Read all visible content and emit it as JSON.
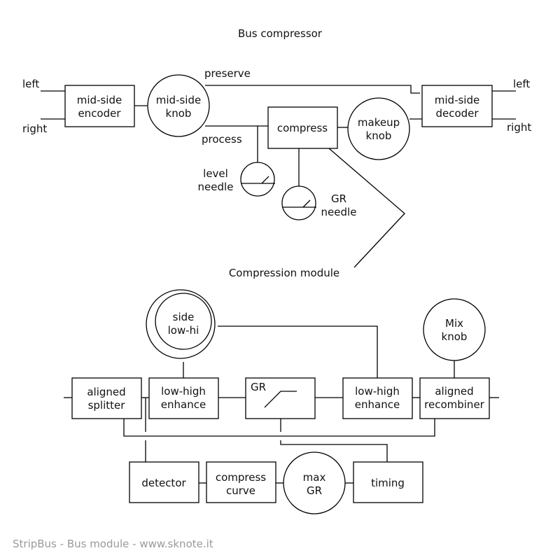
{
  "title": "Bus compressor",
  "top": {
    "io": {
      "left_in": "left",
      "right_in": "right",
      "left_out": "left",
      "right_out": "right"
    },
    "encoder": [
      "mid-side",
      "encoder"
    ],
    "ms_knob": [
      "mid-side",
      "knob"
    ],
    "preserve": "preserve",
    "process": "process",
    "compress": "compress",
    "makeup": [
      "makeup",
      "knob"
    ],
    "decoder": [
      "mid-side",
      "decoder"
    ],
    "level_needle": [
      "level",
      "needle"
    ],
    "gr_needle": [
      "GR",
      "needle"
    ],
    "callout": "Compression module"
  },
  "module": {
    "side_knob": [
      "side",
      "low-hi"
    ],
    "mix_knob": [
      "Mix",
      "knob"
    ],
    "splitter": [
      "aligned",
      "splitter"
    ],
    "enhance1": [
      "low-high",
      "enhance"
    ],
    "gr_box": "GR",
    "enhance2": [
      "low-high",
      "enhance"
    ],
    "recombiner": [
      "aligned",
      "recombiner"
    ],
    "detector": "detector",
    "curve": [
      "compress",
      "curve"
    ],
    "max_gr": [
      "max",
      "GR"
    ],
    "timing": "timing"
  },
  "footer": "StripBus - Bus module - www.sknote.it"
}
